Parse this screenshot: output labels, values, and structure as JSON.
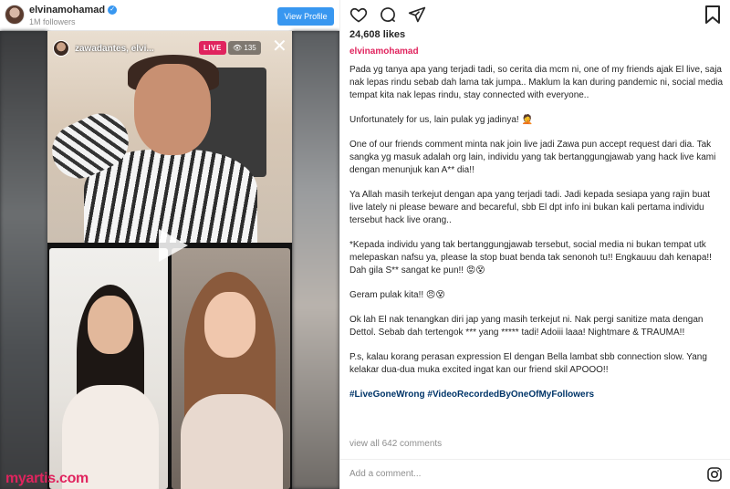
{
  "left_header": {
    "username": "elvinamohamad",
    "followers": "1M followers",
    "view_profile_label": "View Profile"
  },
  "live": {
    "username": "zawadantes, elvi...",
    "badge": "LIVE",
    "viewers": "135",
    "close_icon": "close-icon"
  },
  "watermark": "myartis.com",
  "post": {
    "likes": "24,608 likes",
    "author": "elvinamohamad",
    "caption": [
      "Pada yg tanya apa yang terjadi tadi, so cerita dia mcm ni, one of my friends ajak El live, saja nak lepas rindu sebab dah lama tak jumpa.. Maklum la kan during pandemic ni, social media tempat kita nak lepas rindu, stay connected with everyone..",
      "Unfortunately for us, lain pulak yg jadinya! 🤦",
      "One of our friends comment minta nak join live jadi Zawa pun accept request dari dia. Tak sangka yg masuk adalah org lain, individu yang tak bertanggungjawab yang hack live kami dengan menunjuk kan A** dia!!",
      "Ya Allah masih terkejut dengan apa yang terjadi tadi. Jadi kepada sesiapa yang rajin buat live lately ni please beware and becareful, sbb El dpt info ini bukan kali pertama individu tersebut hack live orang..",
      "*Kepada individu yang tak bertanggungjawab tersebut, social media ni bukan tempat utk melepaskan nafsu ya, please la stop buat benda tak senonoh tu!! Engkauuu dah kenapa!! Dah gila S** sangat ke pun!! 😡😵",
      "Geram pulak kita!! 😠😵",
      "Ok lah El nak tenangkan diri jap yang masih terkejut ni. Nak pergi sanitize mata dengan Dettol. Sebab dah tertengok *** yang ***** tadi! Adoiii laaa! Nightmare & TRAUMA!!",
      "P.s, kalau korang perasan expression El dengan Bella lambat sbb connection slow. Yang kelakar dua-dua muka excited ingat kan our friend skil APOOO!!"
    ],
    "hashtags": "#LiveGoneWrong #VideoRecordedByOneOfMyFollowers",
    "view_comments": "view all 642 comments",
    "comment_placeholder": "Add a comment..."
  },
  "icons": [
    "heart-icon",
    "comment-icon",
    "share-icon",
    "bookmark-icon",
    "play-icon",
    "instagram-icon",
    "verified-icon"
  ]
}
